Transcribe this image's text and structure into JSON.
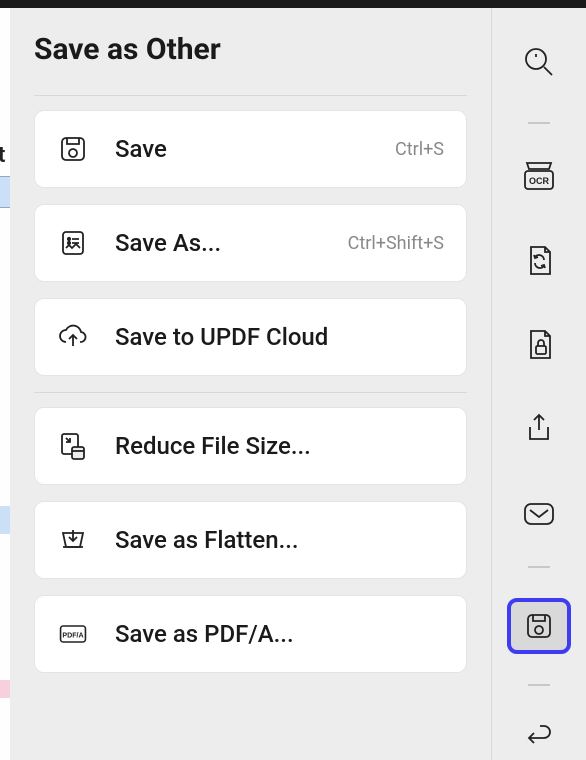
{
  "panel": {
    "title": "Save as Other",
    "groups": [
      [
        {
          "label": "Save",
          "shortcut": "Ctrl+S",
          "icon": "save-icon"
        },
        {
          "label": "Save As...",
          "shortcut": "Ctrl+Shift+S",
          "icon": "save-as-icon"
        },
        {
          "label": "Save to UPDF Cloud",
          "shortcut": "",
          "icon": "cloud-upload-icon"
        }
      ],
      [
        {
          "label": "Reduce File Size...",
          "shortcut": "",
          "icon": "reduce-size-icon"
        },
        {
          "label": "Save as Flatten...",
          "shortcut": "",
          "icon": "flatten-icon"
        },
        {
          "label": "Save as PDF/A...",
          "shortcut": "",
          "icon": "pdfa-icon"
        }
      ]
    ]
  },
  "sidebar": {
    "items": [
      {
        "name": "search-icon"
      },
      {
        "name": "ocr-icon"
      },
      {
        "name": "convert-icon"
      },
      {
        "name": "protect-icon"
      },
      {
        "name": "share-icon"
      },
      {
        "name": "mail-icon"
      },
      {
        "name": "save-other-icon",
        "active": true
      },
      {
        "name": "undo-icon"
      }
    ]
  }
}
